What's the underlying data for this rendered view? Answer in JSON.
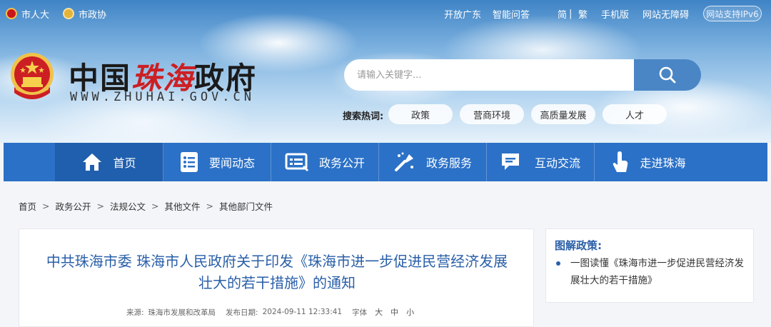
{
  "top_bar": {
    "left": [
      "市人大",
      "市政协"
    ],
    "right": [
      "开放广东",
      "智能问答",
      "简",
      "|",
      "繁",
      "手机版",
      "网站无障碍"
    ],
    "ipv6": "网站支持IPv6"
  },
  "logo": {
    "name_part1": "中国",
    "name_part2": "珠海",
    "name_part3": "政府",
    "url": "WWW.ZHUHAI.GOV.CN"
  },
  "search": {
    "placeholder": "请输入关键字..."
  },
  "hot_search": {
    "label": "搜索热词:",
    "tags": [
      "政策",
      "营商环境",
      "高质量发展",
      "人才"
    ]
  },
  "nav": [
    {
      "label": "首页",
      "icon": "home-icon"
    },
    {
      "label": "要闻动态",
      "icon": "news-icon"
    },
    {
      "label": "政务公开",
      "icon": "openness-icon"
    },
    {
      "label": "政务服务",
      "icon": "service-icon"
    },
    {
      "label": "互动交流",
      "icon": "chat-icon"
    },
    {
      "label": "走进珠海",
      "icon": "hand-pointer-icon"
    }
  ],
  "breadcrumb": [
    "首页",
    "政务公开",
    "法规公文",
    "其他文件",
    "其他部门文件"
  ],
  "article": {
    "title_line1": "中共珠海市委 珠海市人民政府关于印发《珠海市进一步促进民营经济发展",
    "title_line2": "壮大的若干措施》的通知",
    "source_label": "来源:",
    "source": "珠海市发展和改革局",
    "date_label": "发布日期:",
    "date": "2024-09-11 12:33:41",
    "font_label": "字体",
    "font_sizes": [
      "大",
      "中",
      "小"
    ]
  },
  "sidebar": {
    "title": "图解政策:",
    "link": "一图读懂《珠海市进一步促进民营经济发展壮大的若干措施》"
  },
  "colors": {
    "nav_bg": "#2b71c7",
    "nav_active": "#1f5fae",
    "title_blue": "#2a5fa8",
    "logo_red": "#cc1f24"
  }
}
